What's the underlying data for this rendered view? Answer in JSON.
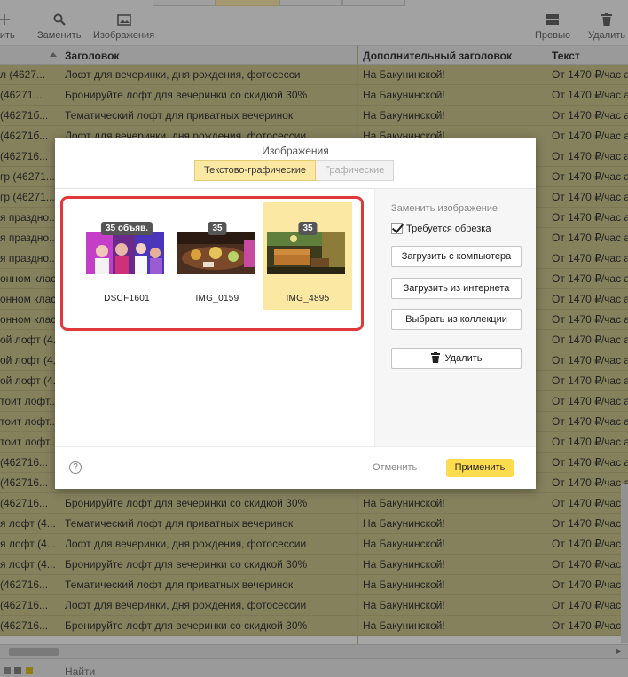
{
  "toolbar": {
    "left_cut_label": "вить",
    "replace_label": "Заменить",
    "images_label": "Изображения",
    "preview_label": "Превью",
    "delete_label": "Удалить"
  },
  "table": {
    "headers": [
      "Заголовок",
      "Дополнительный заголовок",
      "Текст"
    ],
    "rows": [
      [
        "л (4627...",
        "Лофт для вечеринки, дня рождения, фотосесси",
        "На Бакунинской!",
        "От 1470 ₽/час а"
      ],
      [
        "(46271...",
        "Бронируйте лофт для вечеринки со скидкой 30%",
        "На Бакунинской!",
        "От 1470 ₽/час а"
      ],
      [
        "(46271б...",
        "Тематический лофт для приватных вечеринок",
        "На Бакунинской!",
        "От 1470 ₽/час а"
      ],
      [
        "(46271б...",
        "Лофт для вечеринки, дня рождения, фотосессии",
        "На Бакунинской!",
        "От 1470 ₽/час а"
      ],
      [
        "(462716...",
        "",
        "",
        "От 1470 ₽/час а"
      ],
      [
        "гр (46271...",
        "",
        "",
        "От 1470 ₽/час а"
      ],
      [
        "гр (46271...",
        "",
        "",
        "От 1470 ₽/час а"
      ],
      [
        "я праздно...",
        "",
        "",
        "От 1470 ₽/час а"
      ],
      [
        "я праздно...",
        "",
        "",
        "От 1470 ₽/час а"
      ],
      [
        "я праздно...",
        "",
        "",
        "От 1470 ₽/час а"
      ],
      [
        "онном клас...",
        "",
        "",
        "От 1470 ₽/час а"
      ],
      [
        "онном клас...",
        "",
        "",
        "От 1470 ₽/час а"
      ],
      [
        "онном клас...",
        "",
        "",
        "От 1470 ₽/час а"
      ],
      [
        "ой лофт (4...",
        "",
        "",
        "От 1470 ₽/час а"
      ],
      [
        "ой лофт (4...",
        "",
        "",
        "От 1470 ₽/час а"
      ],
      [
        "ой лофт (4...",
        "",
        "",
        "От 1470 ₽/час а"
      ],
      [
        "тоит лофт...",
        "",
        "",
        "От 1470 ₽/час а"
      ],
      [
        "тоит лофт...",
        "",
        "",
        "От 1470 ₽/час а"
      ],
      [
        "тоит лофт...",
        "",
        "",
        "От 1470 ₽/час а"
      ],
      [
        "(462716...",
        "",
        "",
        "От 1470 ₽/час а"
      ],
      [
        "(462716...",
        "Лофт для вечеринки, дня рождения, фотосессии",
        "На Бакунинской!",
        "От 1470 ₽/час а"
      ],
      [
        "(462716...",
        "Бронируйте лофт для вечеринки со скидкой 30%",
        "На Бакунинской!",
        "От 1470 ₽/час а"
      ],
      [
        "я лофт (4...",
        "Тематический лофт для приватных вечеринок",
        "На Бакунинской!",
        "От 1470 ₽/час а"
      ],
      [
        "я лофт (4...",
        "Лофт для вечеринки, дня рождения, фотосессии",
        "На Бакунинской!",
        "От 1470 ₽/час а"
      ],
      [
        "я лофт (4...",
        "Бронируйте лофт для вечеринки со скидкой 30%",
        "На Бакунинской!",
        "От 1470 ₽/час а"
      ],
      [
        "(462716...",
        "Тематический лофт для приватных вечеринок",
        "На Бакунинской!",
        "От 1470 ₽/час а"
      ],
      [
        "(462716...",
        "Лофт для вечеринки, дня рождения, фотосессии",
        "На Бакунинской!",
        "От 1470 ₽/час а"
      ],
      [
        "(462716...",
        "Бронируйте лофт для вечеринки со скидкой 30%",
        "На Бакунинской!",
        "От 1470 ₽/час а"
      ]
    ]
  },
  "bottom": {
    "find_label": "Найти"
  },
  "modal": {
    "title": "Изображения",
    "tabs": [
      "Текстово-графические",
      "Графические"
    ],
    "active_tab": 0,
    "images": [
      {
        "name": "DSCF1601",
        "badge": "35 объяв.",
        "selected": false
      },
      {
        "name": "IMG_0159",
        "badge": "35",
        "selected": false
      },
      {
        "name": "IMG_4895",
        "badge": "35",
        "selected": true
      }
    ],
    "side": {
      "title": "Заменить изображение",
      "crop_label": "Требуется обрезка",
      "crop_checked": true,
      "upload_pc": "Загрузить с компьютера",
      "upload_web": "Загрузить из интернета",
      "from_collection": "Выбрать из коллекции",
      "delete": "Удалить"
    },
    "footer": {
      "help": "?",
      "cancel": "Отменить",
      "apply": "Применить"
    }
  },
  "colors": {
    "row_bg": "#c8c183",
    "accent_yellow": "#ffdc4d",
    "selected_tile": "#fbe9a3",
    "highlight_border": "#e0383b"
  }
}
